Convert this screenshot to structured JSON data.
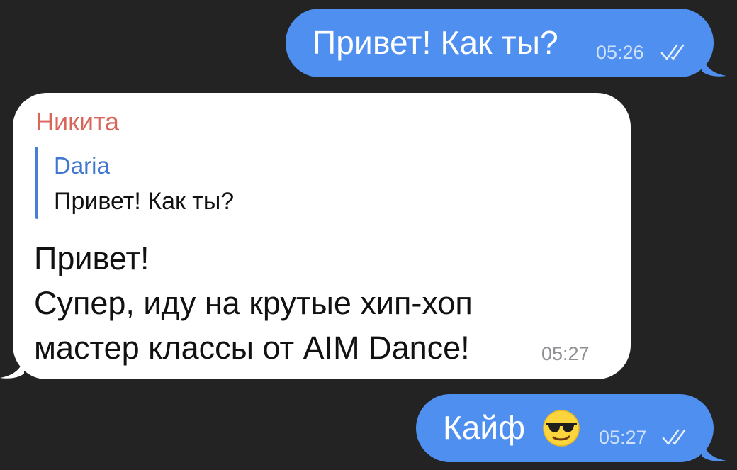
{
  "messages": [
    {
      "direction": "outgoing",
      "text": "Привет! Как ты?",
      "time": "05:26",
      "status_icon": "double-check-icon"
    },
    {
      "direction": "incoming",
      "sender": "Никита",
      "reply": {
        "author": "Daria",
        "text": "Привет! Как ты?"
      },
      "lines": [
        "Привет!",
        "Супер, иду на крутые хип-хоп",
        "мастер классы от AIM Dance!"
      ],
      "time": "05:27"
    },
    {
      "direction": "outgoing",
      "text": "Кайф",
      "emoji": "smiling-face-with-sunglasses",
      "time": "05:27",
      "status_icon": "double-check-icon"
    }
  ],
  "colors": {
    "background": "#232323",
    "outgoing_bubble": "#4e8ff0",
    "incoming_bubble": "#ffffff",
    "sender_name": "#d9655b",
    "reply_author": "#3e76d0"
  }
}
